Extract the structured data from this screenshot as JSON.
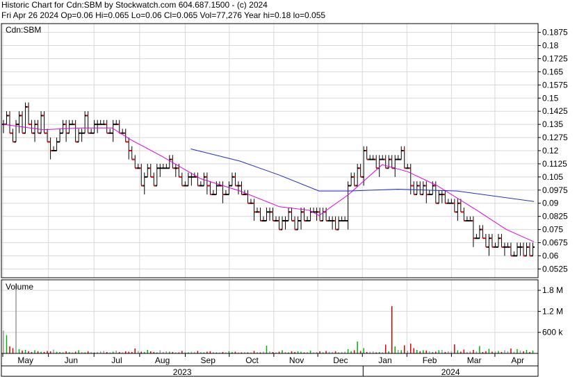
{
  "header": {
    "line1": "Historic Chart for Cdn:SBM by Stockwatch.com 604.687.1500 - (c) 2024",
    "line2": "Fri Apr 26 2024   Op=0.06   Hi=0.065   Lo=0.06   Cl=0.065   Vol=77,276   Year hi=0.18   lo=0.055"
  },
  "colors": {
    "up": "#000000",
    "down": "#d40000",
    "ma_short": "#e000e0",
    "ma_long": "#2030c0",
    "grid": "#d8d8d8",
    "vol_gray": "#9a9a9a",
    "vol_green": "#00b000",
    "vol_red": "#d40000"
  },
  "chart_data": [
    {
      "type": "line",
      "subtype": "ohlc-price",
      "symbol_label": "Cdn:SBM",
      "x_months": [
        "May",
        "Jun",
        "Jul",
        "Aug",
        "Sep",
        "Oct",
        "Nov",
        "Dec",
        "Jan",
        "Feb",
        "Mar",
        "Apr"
      ],
      "years": [
        "2023",
        "2024"
      ],
      "y_ticks": [
        "0.1875",
        "0.18",
        "0.1725",
        "0.165",
        "0.1575",
        "0.15",
        "0.1425",
        "0.135",
        "0.1275",
        "0.12",
        "0.1125",
        "0.105",
        "0.0975",
        "0.09",
        "0.0825",
        "0.075",
        "0.0675",
        "0.06",
        "0.0525"
      ],
      "ylim": [
        0.0475,
        0.1925
      ],
      "grid": true,
      "price_closes": [
        0.135,
        0.14,
        0.13,
        0.125,
        0.135,
        0.14,
        0.13,
        0.145,
        0.135,
        0.13,
        0.135,
        0.13,
        0.14,
        0.13,
        0.125,
        0.12,
        0.12,
        0.125,
        0.13,
        0.135,
        0.13,
        0.135,
        0.135,
        0.125,
        0.13,
        0.13,
        0.14,
        0.13,
        0.13,
        0.135,
        0.135,
        0.135,
        0.135,
        0.13,
        0.13,
        0.135,
        0.135,
        0.13,
        0.13,
        0.125,
        0.12,
        0.115,
        0.11,
        0.11,
        0.1,
        0.105,
        0.11,
        0.105,
        0.1,
        0.11,
        0.11,
        0.11,
        0.11,
        0.115,
        0.11,
        0.11,
        0.105,
        0.1,
        0.1,
        0.105,
        0.105,
        0.105,
        0.1,
        0.1,
        0.105,
        0.1,
        0.095,
        0.095,
        0.1,
        0.1,
        0.095,
        0.095,
        0.1,
        0.105,
        0.1,
        0.1,
        0.095,
        0.095,
        0.09,
        0.09,
        0.085,
        0.085,
        0.08,
        0.08,
        0.085,
        0.085,
        0.08,
        0.08,
        0.075,
        0.08,
        0.08,
        0.085,
        0.08,
        0.075,
        0.08,
        0.085,
        0.08,
        0.08,
        0.085,
        0.085,
        0.085,
        0.08,
        0.085,
        0.08,
        0.08,
        0.08,
        0.075,
        0.08,
        0.08,
        0.08,
        0.1,
        0.105,
        0.1,
        0.11,
        0.105,
        0.12,
        0.115,
        0.115,
        0.115,
        0.11,
        0.115,
        0.115,
        0.11,
        0.115,
        0.11,
        0.115,
        0.115,
        0.12,
        0.11,
        0.11,
        0.1,
        0.095,
        0.1,
        0.095,
        0.1,
        0.095,
        0.095,
        0.1,
        0.09,
        0.095,
        0.095,
        0.09,
        0.09,
        0.09,
        0.085,
        0.09,
        0.085,
        0.08,
        0.08,
        0.08,
        0.07,
        0.07,
        0.075,
        0.07,
        0.065,
        0.07,
        0.065,
        0.065,
        0.07,
        0.065,
        0.065,
        0.065,
        0.06,
        0.06,
        0.065,
        0.065,
        0.06,
        0.065,
        0.06,
        0.065
      ],
      "ma_short": [
        [
          0,
          0.135
        ],
        [
          20,
          0.132
        ],
        [
          40,
          0.133
        ],
        [
          55,
          0.133
        ],
        [
          65,
          0.126
        ],
        [
          80,
          0.117
        ],
        [
          100,
          0.104
        ],
        [
          120,
          0.097
        ],
        [
          140,
          0.088
        ],
        [
          155,
          0.086
        ],
        [
          160,
          0.083
        ],
        [
          175,
          0.095
        ],
        [
          185,
          0.105
        ],
        [
          192,
          0.112
        ],
        [
          205,
          0.108
        ],
        [
          220,
          0.1
        ],
        [
          240,
          0.086
        ],
        [
          255,
          0.075
        ],
        [
          269,
          0.068
        ]
      ],
      "ma_long": [
        [
          95,
          0.121
        ],
        [
          120,
          0.114
        ],
        [
          140,
          0.106
        ],
        [
          160,
          0.097
        ],
        [
          175,
          0.097
        ],
        [
          200,
          0.098
        ],
        [
          230,
          0.097
        ],
        [
          269,
          0.091
        ]
      ]
    },
    {
      "type": "bar",
      "subtype": "volume",
      "title": "Volume",
      "y_ticks": [
        "1.8 M",
        "1.2 M",
        "600 k"
      ],
      "ylim": [
        0,
        2100000
      ],
      "volumes": [
        650000,
        520000,
        200000,
        150000,
        2000000,
        120000,
        80000,
        100000,
        60000,
        40000,
        90000,
        60000,
        50000,
        40000,
        70000,
        60000,
        110000,
        50000,
        40000,
        30000,
        60000,
        40000,
        30000,
        50000,
        90000,
        40000,
        30000,
        60000,
        40000,
        30000,
        40000,
        60000,
        70000,
        40000,
        30000,
        50000,
        80000,
        40000,
        30000,
        60000,
        50000,
        40000,
        140000,
        70000,
        50000,
        40000,
        100000,
        60000,
        40000,
        30000,
        90000,
        40000,
        60000,
        50000,
        40000,
        30000,
        30000,
        70000,
        40000,
        30000,
        50000,
        40000,
        70000,
        40000,
        30000,
        50000,
        60000,
        40000,
        30000,
        30000,
        40000,
        30000,
        60000,
        40000,
        50000,
        30000,
        30000,
        40000,
        30000,
        30000,
        70000,
        40000,
        30000,
        50000,
        220000,
        60000,
        40000,
        30000,
        50000,
        90000,
        40000,
        30000,
        60000,
        40000,
        60000,
        50000,
        30000,
        40000,
        80000,
        30000,
        40000,
        60000,
        30000,
        70000,
        50000,
        40000,
        60000,
        30000,
        40000,
        50000,
        120000,
        60000,
        90000,
        340000,
        70000,
        150000,
        40000,
        50000,
        60000,
        30000,
        40000,
        30000,
        250000,
        60000,
        1350000,
        200000,
        100000,
        90000,
        230000,
        80000,
        280000,
        150000,
        100000,
        60000,
        90000,
        80000,
        60000,
        40000,
        50000,
        90000,
        100000,
        40000,
        60000,
        70000,
        260000,
        90000,
        50000,
        110000,
        40000,
        60000,
        100000,
        60000,
        210000,
        40000,
        60000,
        130000,
        50000,
        60000,
        70000,
        40000,
        90000,
        60000,
        140000,
        50000,
        120000,
        80000,
        60000,
        100000,
        40000,
        77276
      ]
    }
  ]
}
